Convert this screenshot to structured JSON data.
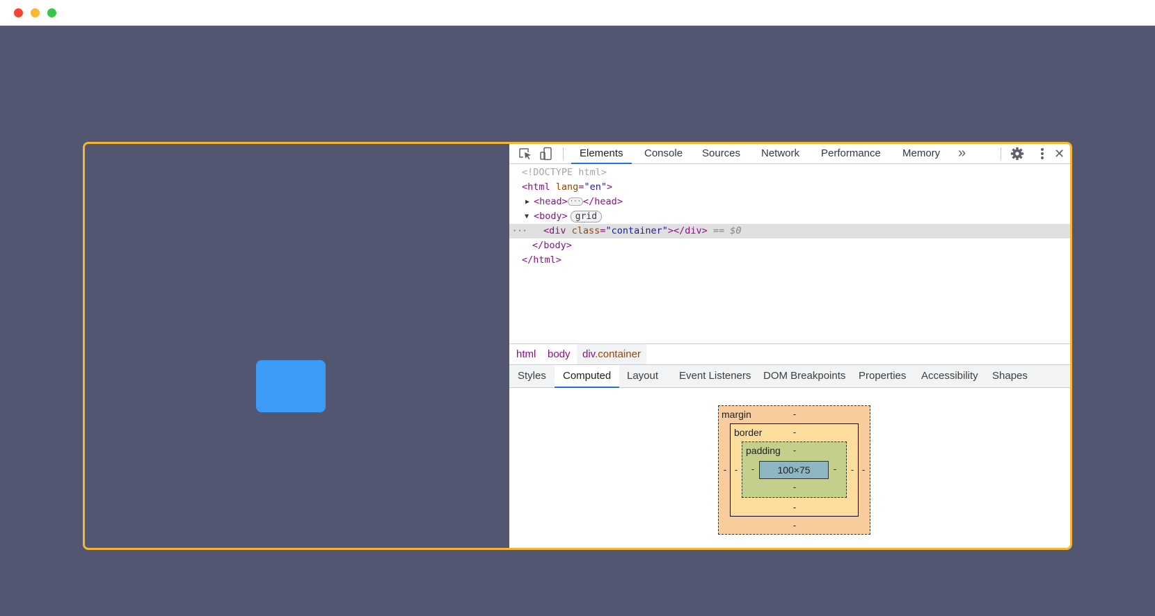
{
  "window": {
    "buttons": [
      "close",
      "minimize",
      "maximize"
    ]
  },
  "colors": {
    "page_bg": "#535671",
    "frame_border": "#f5b72c",
    "box_fill": "#3d9bf8",
    "active_tab_underline": "#1a73e8"
  },
  "devtools": {
    "icons": [
      "inspect-element-icon",
      "device-toolbar-icon",
      "more-tabs-icon",
      "settings-icon",
      "kebab-menu-icon",
      "close-icon"
    ],
    "tabs": [
      "Elements",
      "Console",
      "Sources",
      "Network",
      "Performance",
      "Memory"
    ],
    "active_tab": "Elements",
    "more_tabs_glyph": "»",
    "close_glyph": "✕",
    "dom": {
      "doctype": "<!DOCTYPE html>",
      "html_open": "<html",
      "html_attr_name": "lang",
      "html_attr_value": "\"en\"",
      "html_open_end": ">",
      "head_open": "<head>",
      "head_ellipsis": "···",
      "head_close": "</head>",
      "body_open": "<body>",
      "body_badge": "grid",
      "div_open": "<div",
      "div_attr_name": "class",
      "div_attr_value": "\"container\"",
      "div_close": "></div>",
      "selected_marker": "== $0",
      "row_dots": "···",
      "body_close": "</body>",
      "html_close": "</html>"
    },
    "breadcrumbs": {
      "items": [
        "html",
        "body"
      ],
      "current_tag": "div",
      "current_class": ".container"
    },
    "subtabs": [
      "Styles",
      "Computed",
      "Layout",
      "Event Listeners",
      "DOM Breakpoints",
      "Properties",
      "Accessibility",
      "Shapes"
    ],
    "active_subtab": "Computed",
    "box_model": {
      "margin_label": "margin",
      "border_label": "border",
      "padding_label": "padding",
      "dash": "-",
      "content_size": "100×75"
    }
  }
}
